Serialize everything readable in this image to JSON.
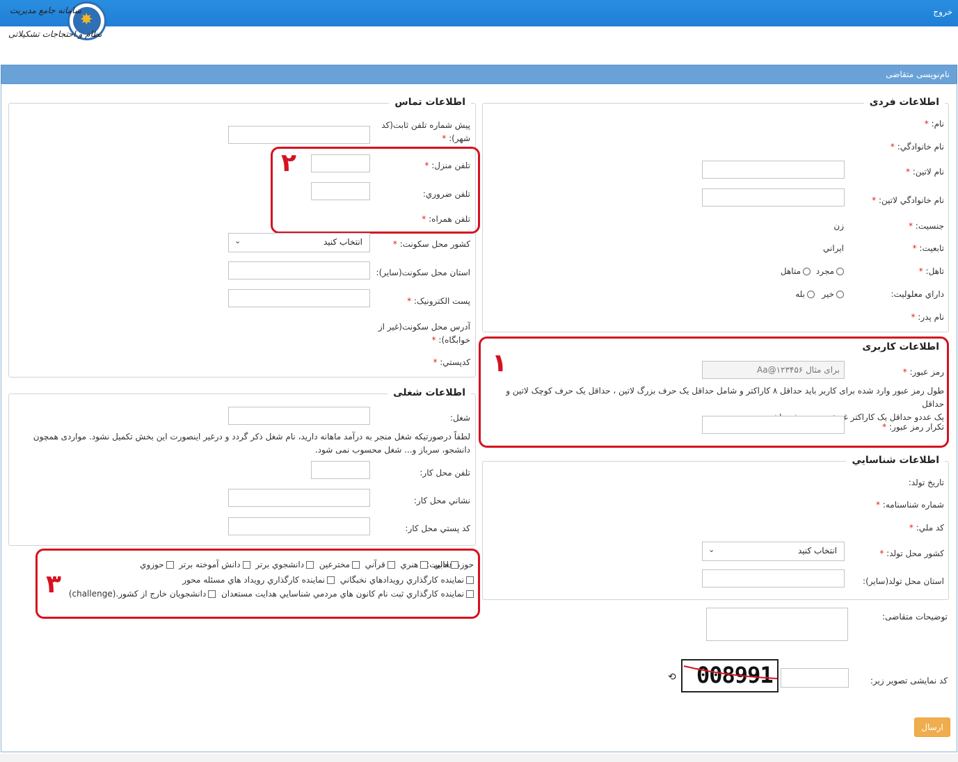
{
  "header": {
    "logout": "خروج",
    "logo_line1": "سامانه جامع مدیریت",
    "logo_line2": "نظام و احتجاجات تشکیلاتی",
    "logo_badge": "سینا"
  },
  "panel": {
    "title": "نام‌نویسی متقاضی"
  },
  "personal": {
    "legend": "اطلاعات فردی",
    "first_name": "نام:",
    "last_name": "نام خانوادگي:",
    "latin_name": "نام لاتین:",
    "latin_last_name": "نام خانوادگي لاتین:",
    "gender": "جنسیت:",
    "gender_value": "زن",
    "nationality": "تابعیت:",
    "nationality_value": "ايراني",
    "marital": "تاهل:",
    "marital_single": "مجرد",
    "marital_married": "متاهل",
    "disability": "داراي معلوليت:",
    "disability_no": "خیر",
    "disability_yes": "بله",
    "father_name": "نام پدر:"
  },
  "user_info": {
    "legend": "اطلاعات کاربری",
    "password": "رمز عبور:",
    "password_placeholder": "برای مثال Aa@۱۲۳۴۵۶",
    "note_line1": "طول رمز عبور وارد شده برای کاربر باید حداقل ۸ کاراکتر و شامل حداقل یک حرف بزرگ لاتین ، حداقل یک حرف کوچک لاتین و حداقل",
    "note_line2": "یک عددو حداقل یک کاراکتر غیرعددی و حرفی باشد.",
    "confirm_password": "تکرار رمز عبور:"
  },
  "identity": {
    "legend": "اطلاعات شناسايي",
    "birth_date": "تاریخ تولد:",
    "id_number": "شماره شناسنامه:",
    "national_code": "کد ملي:",
    "birth_country": "کشور محل تولد:",
    "birth_country_value": "انتخاب کنید",
    "birth_province": "استان محل تولد(سایر):"
  },
  "contact": {
    "legend": "اطلاعات تماس",
    "area_code_line1": "پیش شماره تلفن ثابت(کد",
    "area_code_line2": "شهر):",
    "home_phone": "تلفن منزل:",
    "emergency_phone": "تلفن ضروري:",
    "mobile": "تلفن همراه:",
    "residence_country": "کشور محل سکونت:",
    "residence_country_value": "انتخاب کنید",
    "residence_province": "استان محل سکونت(سایر):",
    "email": "پست الکترونیک:",
    "address_line1": "آدرس محل سکونت(غیر از",
    "address_line2": "خوابگاه):",
    "postal_code": "کدپستي:"
  },
  "job": {
    "legend": "اطلاعات شغلی",
    "job": "شغل:",
    "note_line1": "لطفاً درصورتیکه شغل منجر به درآمد ماهانه دارید، نام شغل ذکر گردد و درغیر اینصورت این بخش تکمیل نشود. مواردی همچون",
    "note_line2": "دانشجو، سرباز و... شغل محسوب نمی شود.",
    "work_phone": "تلفن محل کار:",
    "work_address": "نشاني محل کار:",
    "work_postal": "کد پستي محل کار:"
  },
  "activity": {
    "label": "حوزه فعالیت:",
    "row1": [
      "ادبي",
      "هنري",
      "قرآني",
      "مخترعين",
      "دانشجوي برتر",
      "دانش آموخته برتر",
      "حوزوي"
    ],
    "row2": "نماينده کارگذاري رويدادهاي نخبگاني",
    "row2b": "نماينده کارگذاري رويداد هاي مسئله محور",
    "row3": "نماينده کارگذاري ثبت نام کانون هاي مردمي شناسايي هدايت مستعدان",
    "row3b": "دانشجويان خارج از کشور.(challenge)"
  },
  "extra": {
    "description": "توضیحات متقاضی:",
    "captcha_label": "کد نمایشی تصویر زیر:",
    "captcha_value": "008991",
    "submit": "ارسال"
  },
  "annotations": {
    "n1": "۱",
    "n2": "۲",
    "n3": "۳"
  },
  "colors": {
    "topbar": "#1e7fd6",
    "panel_header": "#6aa2d8",
    "annotation": "#d6121f",
    "submit": "#f0ad4e",
    "required": "#e02020"
  }
}
